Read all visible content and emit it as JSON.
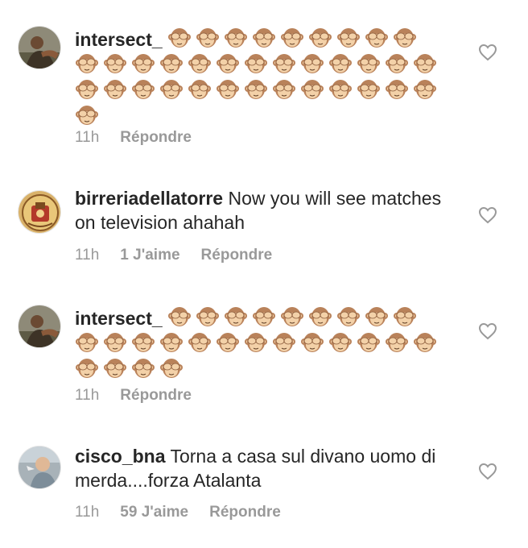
{
  "comments": [
    {
      "username": "intersect_",
      "text": "",
      "emoji_count": 36,
      "emoji_name": "see-no-evil-monkey",
      "time": "11h",
      "likes": "",
      "reply_label": "Répondre"
    },
    {
      "username": "birreriadellatorre",
      "text": "Now you will see matches on television ahahah",
      "emoji_count": 0,
      "time": "11h",
      "likes": "1 J'aime",
      "reply_label": "Répondre"
    },
    {
      "username": "intersect_",
      "text": "",
      "emoji_count": 26,
      "emoji_name": "see-no-evil-monkey",
      "time": "11h",
      "likes": "",
      "reply_label": "Répondre"
    },
    {
      "username": "cisco_bna",
      "text": "Torna a casa sul divano uomo di merda....forza Atalanta",
      "emoji_count": 0,
      "time": "11h",
      "likes": "59 J'aime",
      "reply_label": "Répondre"
    }
  ],
  "colors": {
    "text": "#262626",
    "meta": "#999999",
    "monkey_fur": "#b9825a",
    "monkey_face": "#f3d1a8"
  },
  "icons": {
    "like": "heart-outline-icon"
  }
}
